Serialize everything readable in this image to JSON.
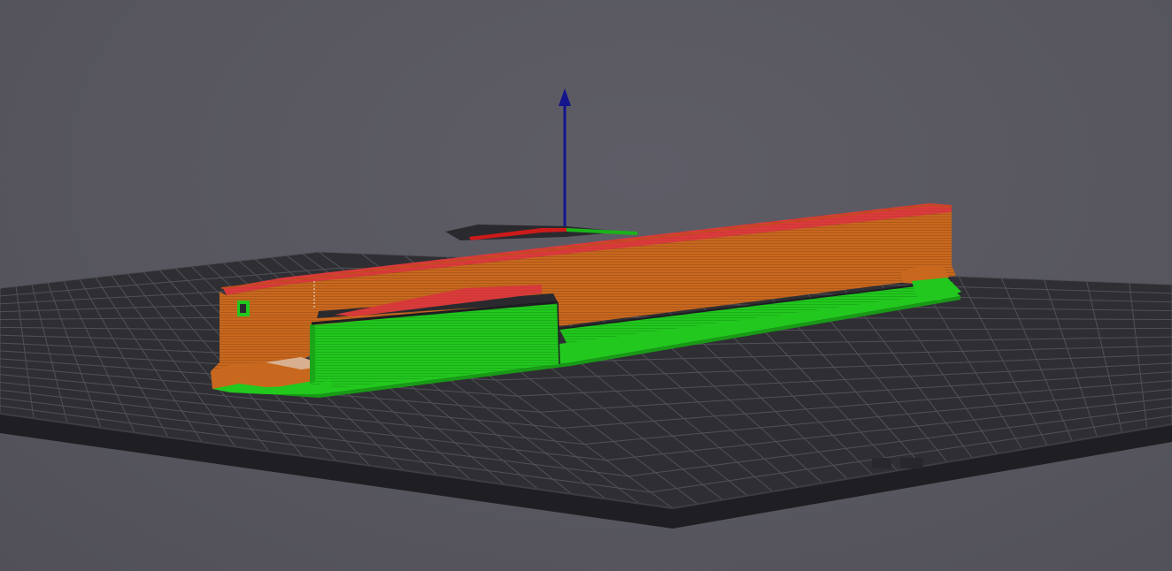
{
  "viewport": {
    "background_color": "#5b5a62",
    "view_mode": "sliced-preview"
  },
  "bed": {
    "surface_color": "#2f2f33",
    "grid_color": "#505058",
    "edge_color": "#1e1e22"
  },
  "axes": {
    "x_color": "#cc1a1a",
    "y_color": "#1ab31a",
    "z_color": "#14148c"
  },
  "model": {
    "perimeter_color": "#c8681e",
    "solid_infill_color": "#22c81e",
    "top_infill_color": "#dc3c3c",
    "seam_color": "#e8e8e8"
  }
}
